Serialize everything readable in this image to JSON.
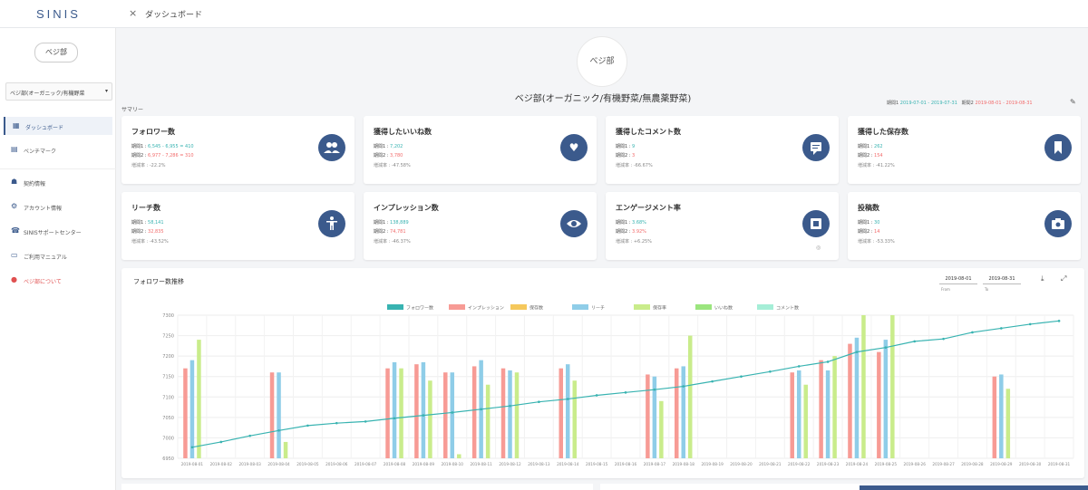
{
  "app": {
    "logo": "SINIS"
  },
  "tab": {
    "close_glyph": "×",
    "title": "ダッシュボード"
  },
  "sidebar": {
    "logo_text": "べジ部",
    "account_select": {
      "value": "ベジ部(オーガニック/有機野菜",
      "caret": "▾"
    },
    "items": [
      {
        "label": "ダッシュボード",
        "icon": "dashboard-icon",
        "glyph": "▦"
      },
      {
        "label": "ベンチマーク",
        "icon": "benchmark-icon",
        "glyph": "▤"
      },
      {
        "label": "契約情報",
        "icon": "contract-icon",
        "glyph": "☗"
      },
      {
        "label": "アカウント情報",
        "icon": "account-icon",
        "glyph": "⚙"
      },
      {
        "label": "SINISサポートセンター",
        "icon": "phone-icon",
        "glyph": "☎"
      },
      {
        "label": "ご利用マニュアル",
        "icon": "manual-icon",
        "glyph": "▭"
      },
      {
        "label": "ベジ部について",
        "icon": "info-icon",
        "glyph": "●"
      }
    ]
  },
  "header": {
    "avatar_text": "べジ部",
    "account_title": "ベジ部(オーガニック/有機野菜/無農薬野菜)",
    "summary_label": "サマリー",
    "period1_label": "期間1",
    "period1": "2019-07-01 - 2019-07-31",
    "period2_label": "期間2",
    "period2": "2019-08-01 - 2019-08-31",
    "edit_glyph": "✎"
  },
  "colors": {
    "accent": "#3b5a8c",
    "period1": "#38b3b1",
    "period2": "#f26b6b"
  },
  "cards": [
    {
      "title": "フォロワー数",
      "l1_label": "期間1 : ",
      "l1": "6,545 - 6,955 = 410",
      "l2_label": "期間2 : ",
      "l2": "6,977 - 7,286 = 310",
      "l3": "増減率 : -22.2%",
      "icon": "followers-icon",
      "glyph": "👥"
    },
    {
      "title": "獲得したいいね数",
      "l1_label": "期間1 : ",
      "l1": "7,202",
      "l2_label": "期間2 : ",
      "l2": "3,780",
      "l3": "増減率 : -47.58%",
      "icon": "heart-icon",
      "glyph": "♥"
    },
    {
      "title": "獲得したコメント数",
      "l1_label": "期間1 : ",
      "l1": "9",
      "l2_label": "期間2 : ",
      "l2": "3",
      "l3": "増減率 : -66.67%",
      "icon": "comment-icon",
      "glyph": "▤"
    },
    {
      "title": "獲得した保存数",
      "l1_label": "期間1 : ",
      "l1": "262",
      "l2_label": "期間2 : ",
      "l2": "154",
      "l3": "増減率 : -41.22%",
      "icon": "bookmark-icon",
      "glyph": "▮"
    },
    {
      "title": "リーチ数",
      "l1_label": "期間1 : ",
      "l1": "58,141",
      "l2_label": "期間2 : ",
      "l2": "32,835",
      "l3": "増減率 : -43.52%",
      "icon": "reach-icon",
      "glyph": "✝"
    },
    {
      "title": "インプレッション数",
      "l1_label": "期間1 : ",
      "l1": "138,889",
      "l2_label": "期間2 : ",
      "l2": "74,781",
      "l3": "増減率 : -46.37%",
      "icon": "eye-icon",
      "glyph": "◉"
    },
    {
      "title": "エンゲージメント率",
      "l1_label": "期間1 : ",
      "l1": "3.68%",
      "l2_label": "期間2 : ",
      "l2": "3.92%",
      "l3": "増減率 : +6.25%",
      "icon": "engagement-icon",
      "glyph": "▣",
      "mark": "◎"
    },
    {
      "title": "投稿数",
      "l1_label": "期間1 : ",
      "l1": "30",
      "l2_label": "期間2 : ",
      "l2": "14",
      "l3": "増減率 : -53.33%",
      "icon": "camera-icon",
      "glyph": "◙"
    }
  ],
  "chart_panel": {
    "title": "フォロワー数推移",
    "from_value": "2019-08-01",
    "to_value": "2019-08-31",
    "from_label": "From",
    "to_label": "To",
    "download_glyph": "⤓",
    "expand_glyph": "⤢"
  },
  "chart_data": {
    "type": "bar",
    "legend": [
      {
        "name": "フォロワー数",
        "color": "#38b3b1"
      },
      {
        "name": "インプレッション",
        "color": "#f79b95"
      },
      {
        "name": "保存数",
        "color": "#f5c85c"
      },
      {
        "name": "リーチ",
        "color": "#8fcde8"
      },
      {
        "name": "保存率",
        "color": "#c9ec8b"
      },
      {
        "name": "いいね数",
        "color": "#9be57e"
      },
      {
        "name": "コメント数",
        "color": "#a5eed7"
      }
    ],
    "y_ticks": [
      "7300",
      "7250",
      "7200",
      "7150",
      "7100",
      "7050",
      "7000",
      "6950"
    ],
    "ylim": [
      6950,
      7300
    ],
    "categories": [
      "2019-08-01",
      "2019-08-02",
      "2019-08-03",
      "2019-08-04",
      "2019-08-05",
      "2019-08-06",
      "2019-08-07",
      "2019-08-08",
      "2019-08-09",
      "2019-08-10",
      "2019-08-11",
      "2019-08-12",
      "2019-08-13",
      "2019-08-14",
      "2019-08-15",
      "2019-08-16",
      "2019-08-17",
      "2019-08-18",
      "2019-08-19",
      "2019-08-20",
      "2019-08-21",
      "2019-08-22",
      "2019-08-23",
      "2019-08-24",
      "2019-08-25",
      "2019-08-26",
      "2019-08-27",
      "2019-08-28",
      "2019-08-29",
      "2019-08-30",
      "2019-08-31"
    ],
    "line": {
      "name": "フォロワー数",
      "values": [
        6977,
        6990,
        7005,
        7018,
        7030,
        7036,
        7040,
        7048,
        7055,
        7062,
        7070,
        7078,
        7088,
        7095,
        7104,
        7111,
        7118,
        7126,
        7138,
        7150,
        7162,
        7175,
        7186,
        7210,
        7221,
        7236,
        7242,
        7258,
        7268,
        7278,
        7286
      ]
    },
    "bars": [
      {
        "name": "インプレッション",
        "color": "#f79b95",
        "values": [
          7170,
          null,
          null,
          7160,
          null,
          null,
          null,
          7170,
          7180,
          7160,
          7175,
          7170,
          null,
          7170,
          null,
          null,
          7155,
          7170,
          null,
          null,
          null,
          7160,
          7190,
          7230,
          7210,
          null,
          null,
          null,
          7150,
          null,
          null
        ]
      },
      {
        "name": "リーチ",
        "color": "#8fcde8",
        "values": [
          7190,
          null,
          null,
          7160,
          null,
          null,
          null,
          7185,
          7185,
          7160,
          7190,
          7165,
          null,
          7180,
          null,
          null,
          7150,
          7175,
          null,
          null,
          null,
          7165,
          7165,
          7245,
          7240,
          null,
          null,
          null,
          7155,
          null,
          null
        ]
      },
      {
        "name": "保存率",
        "color": "#c9ec8b",
        "values": [
          7240,
          null,
          null,
          6990,
          null,
          null,
          null,
          7170,
          7140,
          6960,
          7130,
          7160,
          null,
          7140,
          null,
          null,
          7090,
          7250,
          null,
          null,
          null,
          7130,
          7200,
          7300,
          7300,
          null,
          null,
          null,
          7120,
          null,
          null
        ]
      }
    ]
  }
}
